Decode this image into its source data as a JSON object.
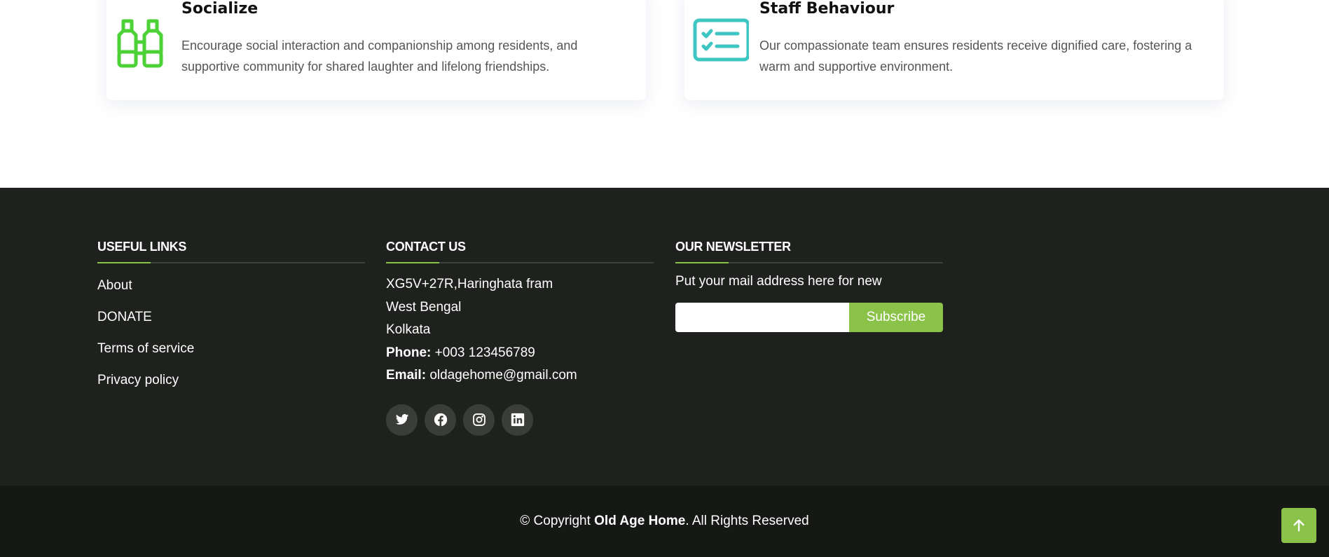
{
  "features": [
    {
      "title": "Socialize",
      "description": "Encourage social interaction and companionship among residents, and supportive community for shared laughter and lifelong friendships.",
      "icon": "binoculars-icon",
      "color": "#4cd137"
    },
    {
      "title": "Staff Behaviour",
      "description": "Our compassionate team ensures residents receive dignified care, fostering a warm and supportive environment.",
      "icon": "checklist-icon",
      "color": "#3ec7c2"
    }
  ],
  "footer": {
    "useful_links": {
      "heading": "USEFUL LINKS",
      "items": [
        "About",
        "DONATE",
        "Terms of service",
        "Privacy policy"
      ]
    },
    "contact": {
      "heading": "CONTACT US",
      "address": [
        "XG5V+27R,Haringhata fram",
        "West Bengal",
        "Kolkata"
      ],
      "phone_label": "Phone:",
      "phone": "+003 123456789",
      "email_label": "Email:",
      "email": "oldagehome@gmail.com",
      "socials": [
        "twitter-icon",
        "facebook-icon",
        "instagram-icon",
        "linkedin-icon"
      ]
    },
    "newsletter": {
      "heading": "OUR NEWSLETTER",
      "intro": "Put your mail address here for new",
      "email_value": "",
      "button_label": "Subscribe"
    },
    "copyright": {
      "prefix": "© Copyright",
      "brand": "Old Age Home",
      "suffix": ". All Rights Reserved"
    },
    "back_to_top_icon": "arrow-up-icon"
  },
  "colors": {
    "accent": "#8bc34a",
    "footer_bg": "#1e211d",
    "bottom_bar_bg": "#161815"
  }
}
